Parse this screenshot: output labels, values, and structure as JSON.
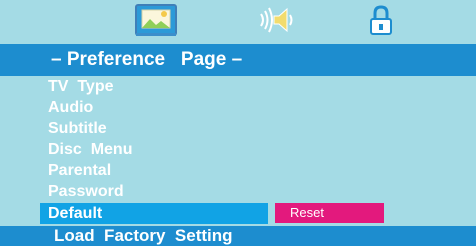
{
  "icons": [
    {
      "name": "photo-icon",
      "selected": true
    },
    {
      "name": "speaker-icon",
      "selected": false
    },
    {
      "name": "lock-icon",
      "selected": false
    }
  ],
  "header": {
    "title": "– Preference   Page –"
  },
  "menu": {
    "items": [
      {
        "label": "TV  Type"
      },
      {
        "label": "Audio"
      },
      {
        "label": "Subtitle"
      },
      {
        "label": "Disc  Menu"
      },
      {
        "label": "Parental"
      },
      {
        "label": "Password"
      },
      {
        "label": "Default"
      }
    ],
    "selected_index": 6,
    "selected_value": "Reset"
  },
  "footer": {
    "text": "Load  Factory  Setting"
  },
  "colors": {
    "background": "#a4dbe5",
    "header": "#1d8dcf",
    "highlight": "#11a3e5",
    "value_pill": "#e3197d",
    "text": "#ffffff"
  }
}
